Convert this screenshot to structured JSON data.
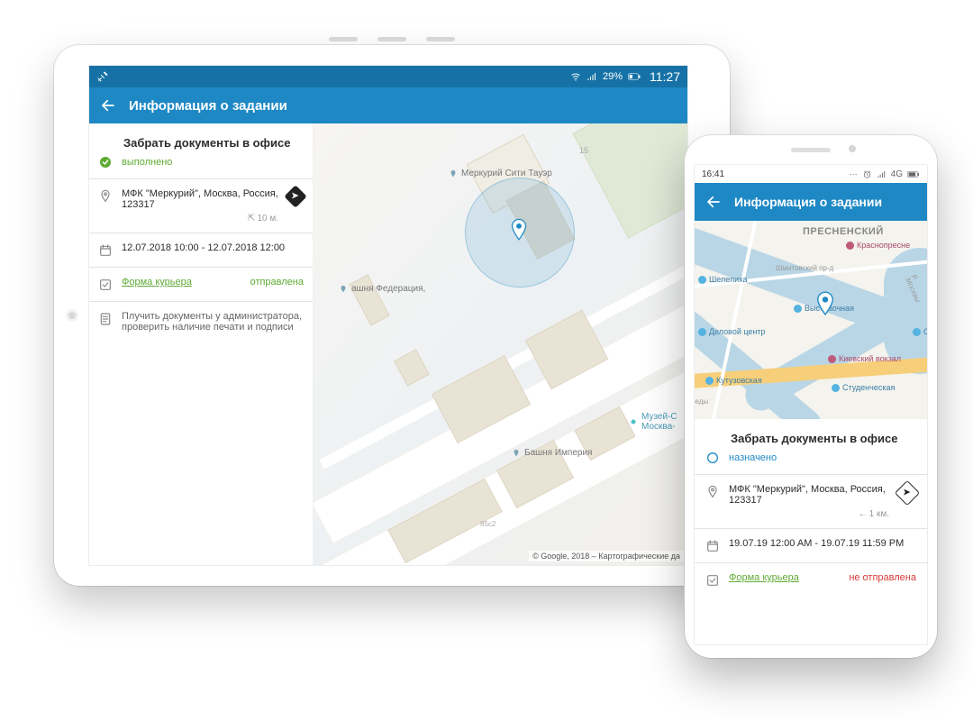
{
  "tablet": {
    "status_bar": {
      "battery": "29%",
      "time": "11:27"
    },
    "appbar": {
      "title": "Информация о задании"
    },
    "task": {
      "title": "Забрать документы в офисе",
      "status_label": "выполнено",
      "status_color": "#5eaa33",
      "address": "МФК \"Меркурий\", Москва, Россия, 123317",
      "distance": "10 м.",
      "time_window": "12.07.2018 10:00 - 12.07.2018 12:00",
      "form_link": "Форма курьера",
      "form_status": "отправлена",
      "notes": "Плучить документы у администратора, проверить наличие печати и подписи"
    },
    "map": {
      "poi_mercury": "Меркурий Сити Тауэр",
      "poi_federation": "ашня Федерация,",
      "poi_empire": "Башня Империя",
      "poi_museum": "Музей-С\nМосква-",
      "building_number": "15",
      "road_label": "85с2",
      "attribution": "© Google, 2018 – Картографические да"
    }
  },
  "phone": {
    "status_bar": {
      "time": "16:41",
      "network": "4G"
    },
    "appbar": {
      "title": "Информация о задании"
    },
    "map": {
      "district": "ПРЕСНЕНСКИЙ",
      "station_shelepikha": "Шелепиха",
      "station_delovoy": "Деловой центр",
      "station_vystavochnaya": "Выставочная",
      "station_kutuzovskaya": "Кутузовская",
      "station_studencheskaya": "Студенческая",
      "station_krasnopresn": "Краснопресне",
      "station_kievsky": "Киевский вокзал",
      "station_sm": "См",
      "road_shmit": "Шмитовский пр-д",
      "road_bedy": "беды",
      "road_moskvy": "р. Москвы"
    },
    "task": {
      "title": "Забрать документы в офисе",
      "status_label": "назначено",
      "status_color": "#1e88c5",
      "address": "МФК \"Меркурий\", Москва, Россия, 123317",
      "distance": "1 км.",
      "time_window": "19.07.19 12:00 AM - 19.07.19 11:59 PM",
      "form_link": "Форма курьера",
      "form_status": "не отправлена"
    }
  }
}
